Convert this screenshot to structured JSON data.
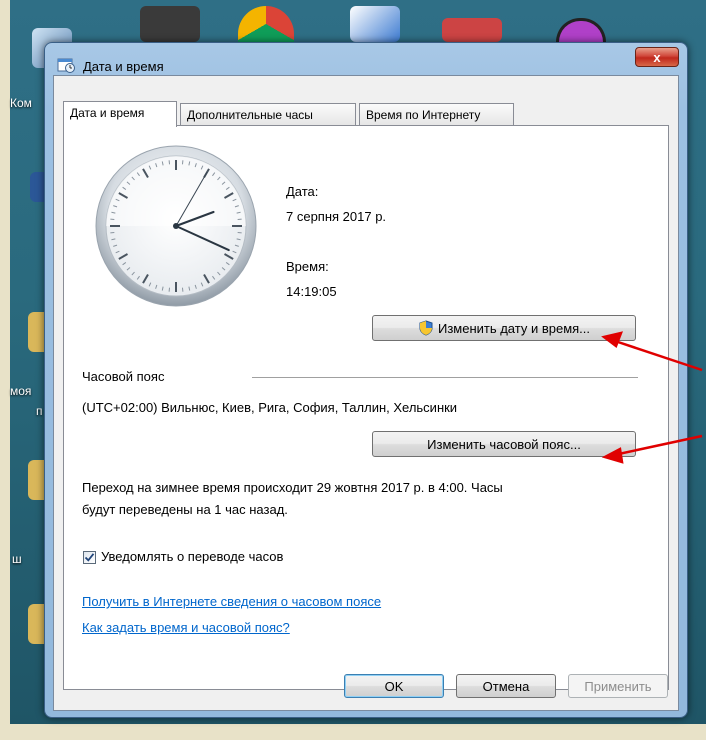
{
  "window": {
    "title": "Дата и время",
    "close_label": "x"
  },
  "desktop": {
    "labels": [
      "Ком",
      "моя",
      "п",
      "ш"
    ]
  },
  "tabs": [
    {
      "label": "Дата и время",
      "active": true
    },
    {
      "label": "Дополнительные часы",
      "active": false
    },
    {
      "label": "Время по Интернету",
      "active": false
    }
  ],
  "date": {
    "label": "Дата:",
    "value": "7 серпня 2017 р."
  },
  "time": {
    "label": "Время:",
    "value": "14:19:05",
    "hour": 14,
    "minute": 19,
    "second": 5
  },
  "buttons": {
    "change_datetime": "Изменить дату и время...",
    "change_timezone": "Изменить часовой пояс...",
    "ok": "OK",
    "cancel": "Отмена",
    "apply": "Применить"
  },
  "timezone": {
    "section_label": "Часовой пояс",
    "value": "(UTC+02:00) Вильнюс, Киев, Рига, София, Таллин, Хельсинки"
  },
  "dst_notice": {
    "line1": "Переход на зимнее время происходит 29 жовтня 2017 р. в 4:00. Часы",
    "line2": "будут переведены на 1 час назад."
  },
  "notify": {
    "label": "Уведомлять о переводе часов",
    "checked": true
  },
  "links": {
    "tz_info": "Получить в Интернете сведения о часовом поясе",
    "how_to": "Как задать время и часовой пояс?"
  },
  "colors": {
    "link": "#0066cc",
    "annotation_arrow": "#e00000"
  }
}
